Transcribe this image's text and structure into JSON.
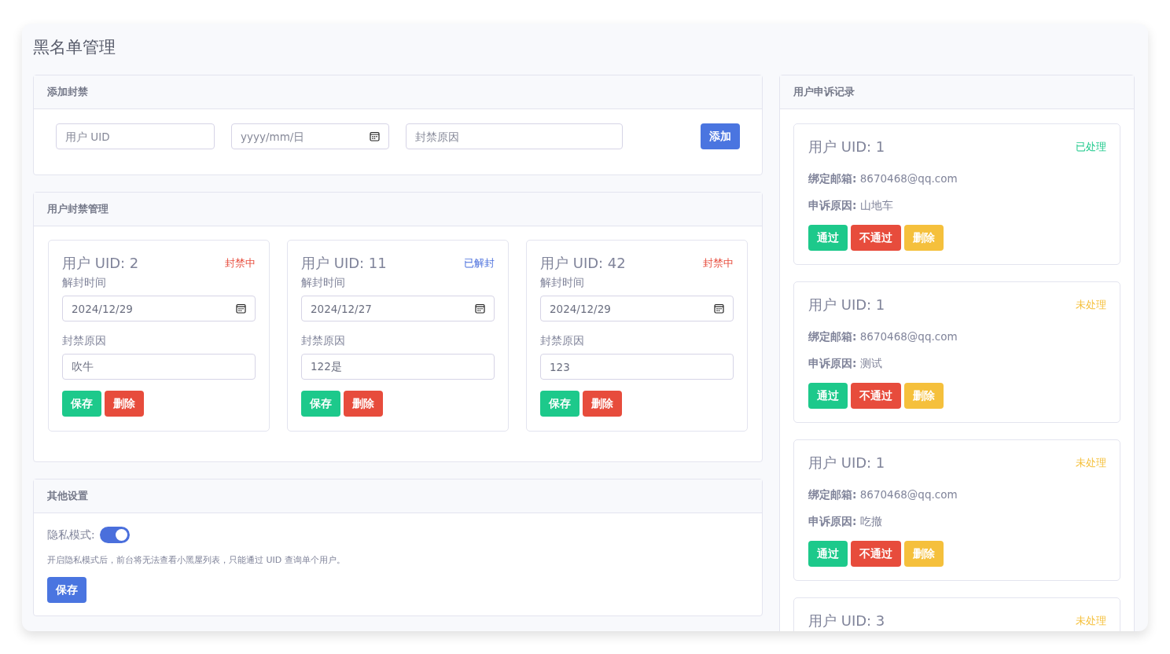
{
  "page_title": "黑名单管理",
  "add_ban": {
    "title": "添加封禁",
    "uid_placeholder": "用户 UID",
    "date_placeholder": "yyyy/mm/日",
    "reason_placeholder": "封禁原因",
    "button": "添加"
  },
  "ban_management": {
    "title": "用户封禁管理",
    "cards": [
      {
        "uid": "用户 UID: 2",
        "status": "封禁中",
        "color": "#e74c3c",
        "date_label": "解封时间",
        "date": "2024/12/29",
        "reason_label": "封禁原因",
        "reason": "吹牛",
        "save": "保存",
        "delete": "删除"
      },
      {
        "uid": "用户 UID: 11",
        "status": "已解封",
        "color": "#4a6fdc",
        "date_label": "解封时间",
        "date": "2024/12/27",
        "reason_label": "封禁原因",
        "reason": "122是",
        "save": "保存",
        "delete": "删除"
      },
      {
        "uid": "用户 UID: 42",
        "status": "封禁中",
        "color": "#e74c3c",
        "date_label": "解封时间",
        "date": "2024/12/29",
        "reason_label": "封禁原因",
        "reason": "123",
        "save": "保存",
        "delete": "删除"
      }
    ]
  },
  "other_settings": {
    "title": "其他设置",
    "privacy_label": "隐私模式:",
    "privacy_on": true,
    "note": "开启隐私模式后，前台将无法查看小黑屋列表，只能通过 UID 查询单个用户。",
    "save": "保存"
  },
  "appeals": {
    "title": "用户申诉记录",
    "items": [
      {
        "uid": "用户 UID: 1",
        "status": "已处理",
        "color": "#1dc98b",
        "email": "**绑定邮箱:** 8670468@qq.com",
        "reason": "**申诉原因:** 山地车",
        "buttons": [
          "通过",
          "不通过",
          "删除"
        ]
      },
      {
        "uid": "用户 UID: 1",
        "status": "未处理",
        "color": "#f5c03c",
        "email": "**绑定邮箱:** 8670468@qq.com",
        "reason": "**申诉原因:** 测试",
        "buttons": [
          "通过",
          "不通过",
          "删除"
        ]
      },
      {
        "uid": "用户 UID: 1",
        "status": "未处理",
        "color": "#f5c03c",
        "email": "**绑定邮箱:** 8670468@qq.com",
        "reason": "**申诉原因:** 吃撤",
        "buttons": [
          "通过",
          "不通过",
          "删除"
        ]
      },
      {
        "uid": "用户 UID: 3",
        "status": "未处理",
        "color": "#f5c03c"
      }
    ]
  }
}
